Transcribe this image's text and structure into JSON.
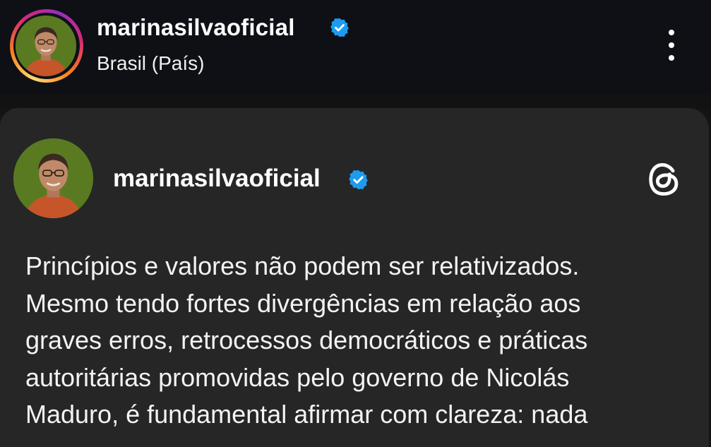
{
  "header": {
    "username": "marinasilvaoficial",
    "location": "Brasil (País)",
    "verified_icon": "verified-badge-icon",
    "more_icon": "more-vertical-icon"
  },
  "post": {
    "username": "marinasilvaoficial",
    "verified_icon": "verified-badge-icon",
    "app_icon": "threads-icon",
    "text_lines": [
      "Princípios e valores não podem ser relativizados.",
      "Mesmo tendo fortes divergências em relação aos",
      "graves erros, retrocessos democráticos e práticas",
      "autoritárias promovidas pelo governo de Nicolás",
      "Maduro, é fundamental afirmar com clareza: nada"
    ]
  },
  "colors": {
    "header_bg": "#0e1016",
    "card_bg": "#262626",
    "verified_blue": "#1d9bf0",
    "text": "#f3f3f3"
  }
}
